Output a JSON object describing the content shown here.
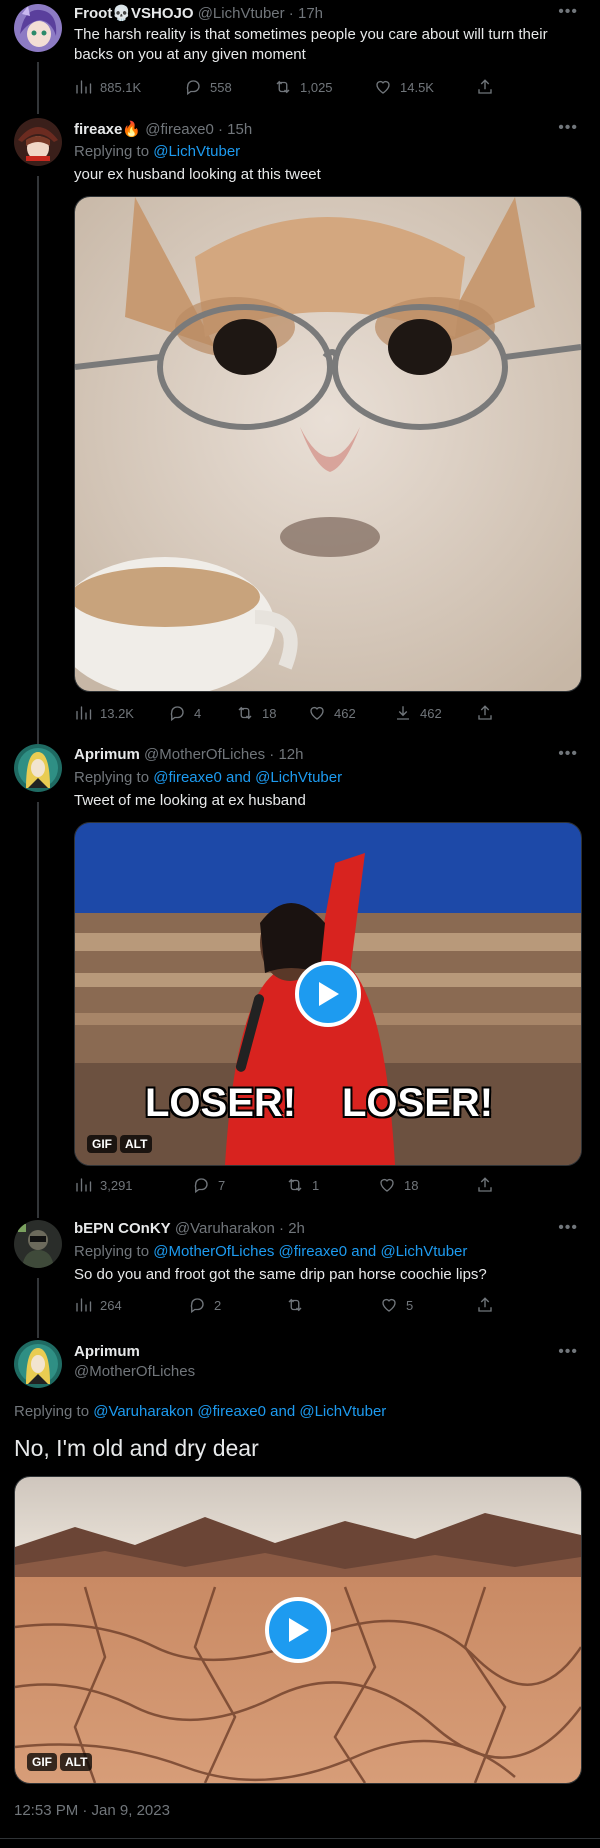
{
  "tweets": [
    {
      "name": "Froot💀VSHOJO",
      "meta": "@LichVtuber · 17h",
      "text": "The harsh reality is that sometimes people you care about will turn their backs on you at any given moment",
      "views": "885.1K",
      "replies": "558",
      "retweets": "1,025",
      "likes": "14.5K"
    },
    {
      "name": "fireaxe🔥",
      "meta": "@fireaxe0 · 15h",
      "replying_prefix": "Replying to ",
      "replying_to": "@LichVtuber",
      "text": "your ex husband looking at this tweet",
      "views": "13.2K",
      "replies": "4",
      "retweets": "18",
      "likes": "462",
      "downloads": "462"
    },
    {
      "name": "Aprimum",
      "meta": "@MotherOfLiches · 12h",
      "replying_prefix": "Replying to ",
      "replying_to": "@fireaxe0 and @LichVtuber",
      "text": "Tweet of me looking at ex husband",
      "gif_caption_left": "LOSER!",
      "gif_caption_right": "LOSER!",
      "badge_gif": "GIF",
      "badge_alt": "ALT",
      "views": "3,291",
      "replies": "7",
      "retweets": "1",
      "likes": "18"
    },
    {
      "name": "bEPN COnKY",
      "meta": "@Varuharakon · 2h",
      "replying_prefix": "Replying to ",
      "replying_to": "@MotherOfLiches @fireaxe0 and @LichVtuber",
      "text": "So do you and froot got the same drip pan horse coochie lips?",
      "views": "264",
      "replies": "2",
      "retweets": "",
      "likes": "5"
    }
  ],
  "main_tweet": {
    "name": "Aprimum",
    "handle": "@MotherOfLiches",
    "replying_prefix": "Replying to ",
    "replying_to": "@Varuharakon @fireaxe0 and @LichVtuber",
    "text": "No, I'm old and dry dear",
    "badge_gif": "GIF",
    "badge_alt": "ALT",
    "timestamp": "12:53 PM · Jan 9, 2023"
  },
  "colors": {
    "accent": "#1d9bf0",
    "muted": "#71767b",
    "text": "#e7e9ea",
    "border": "#2f3336"
  }
}
